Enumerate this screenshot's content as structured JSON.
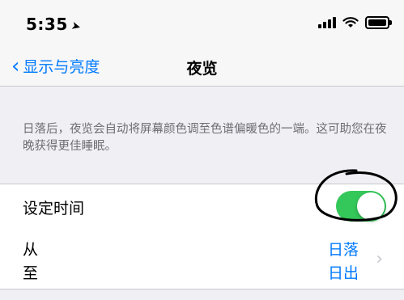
{
  "status_bar": {
    "time": "5:35",
    "location_icon": "location-arrow-icon",
    "signal_icon": "signal-icon",
    "wifi_icon": "wifi-icon",
    "battery_icon": "battery-icon"
  },
  "nav": {
    "back_label": "显示与亮度",
    "title": "夜览"
  },
  "description": "日落后，夜览会自动将屏幕颜色调至色谱偏暖色的一端。这可助您在夜晚获得更佳睡眠。",
  "schedule": {
    "label": "设定时间",
    "enabled": true,
    "from_label": "从",
    "to_label": "至",
    "from_value": "日落",
    "to_value": "日出"
  },
  "colors": {
    "accent": "#007aff",
    "toggle_on": "#34c759",
    "annotation_stroke": "#000000"
  }
}
